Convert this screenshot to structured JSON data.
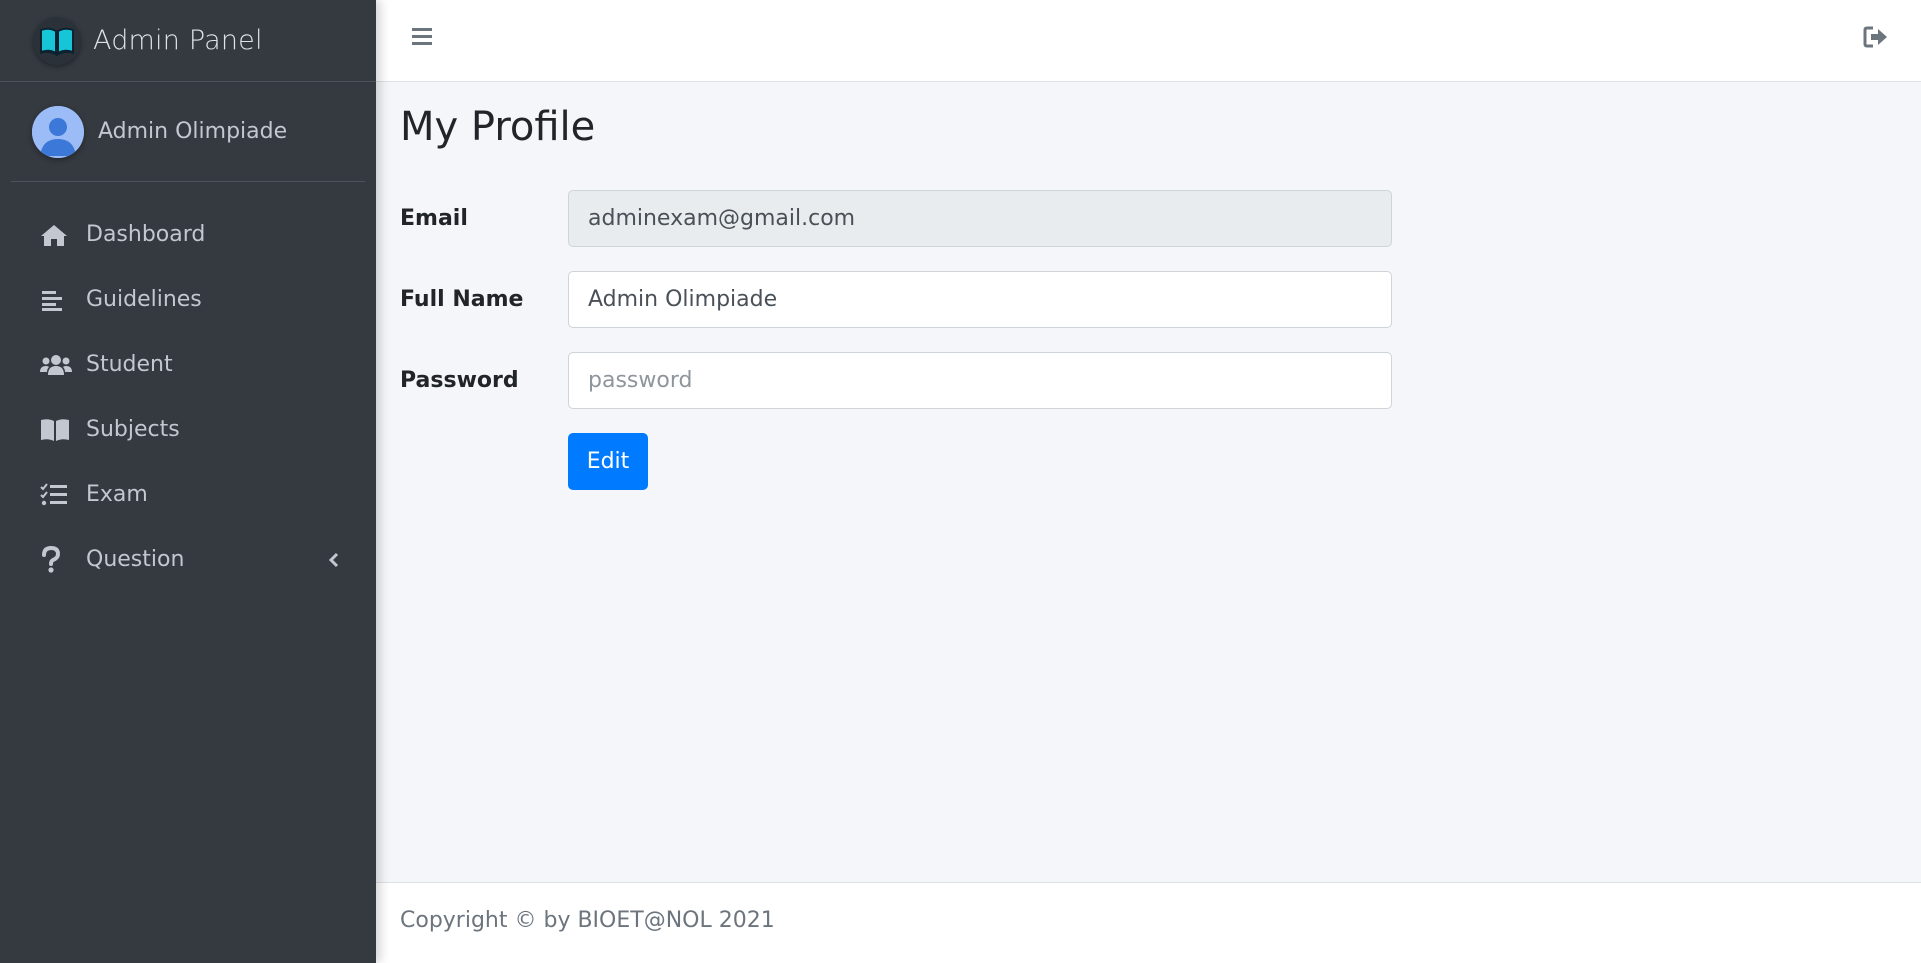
{
  "sidebar": {
    "brand": {
      "text": "Admin Panel",
      "icon": "book-open-icon"
    },
    "user": {
      "name": "Admin Olimpiade",
      "avatar": "user-avatar"
    },
    "items": [
      {
        "label": "Dashboard",
        "icon": "home-icon"
      },
      {
        "label": "Guidelines",
        "icon": "align-left-icon"
      },
      {
        "label": "Student",
        "icon": "users-icon"
      },
      {
        "label": "Subjects",
        "icon": "book-icon"
      },
      {
        "label": "Exam",
        "icon": "tasks-icon"
      },
      {
        "label": "Question",
        "icon": "question-icon",
        "expandable": true
      }
    ]
  },
  "topbar": {
    "menu_icon": "bars-icon",
    "logout_icon": "sign-out-icon"
  },
  "page": {
    "title": "My Profile"
  },
  "form": {
    "email": {
      "label": "Email",
      "value": "adminexam@gmail.com",
      "readonly": true
    },
    "full_name": {
      "label": "Full Name",
      "value": "Admin Olimpiade"
    },
    "password": {
      "label": "Password",
      "value": "",
      "placeholder": "password"
    },
    "submit_label": "Edit"
  },
  "footer": {
    "text": "Copyright © by BIOET@NOL 2021"
  },
  "colors": {
    "sidebar_bg": "#343a40",
    "content_bg": "#f4f6f9",
    "primary": "#007bff",
    "brand_teal": "#17c6d6"
  }
}
